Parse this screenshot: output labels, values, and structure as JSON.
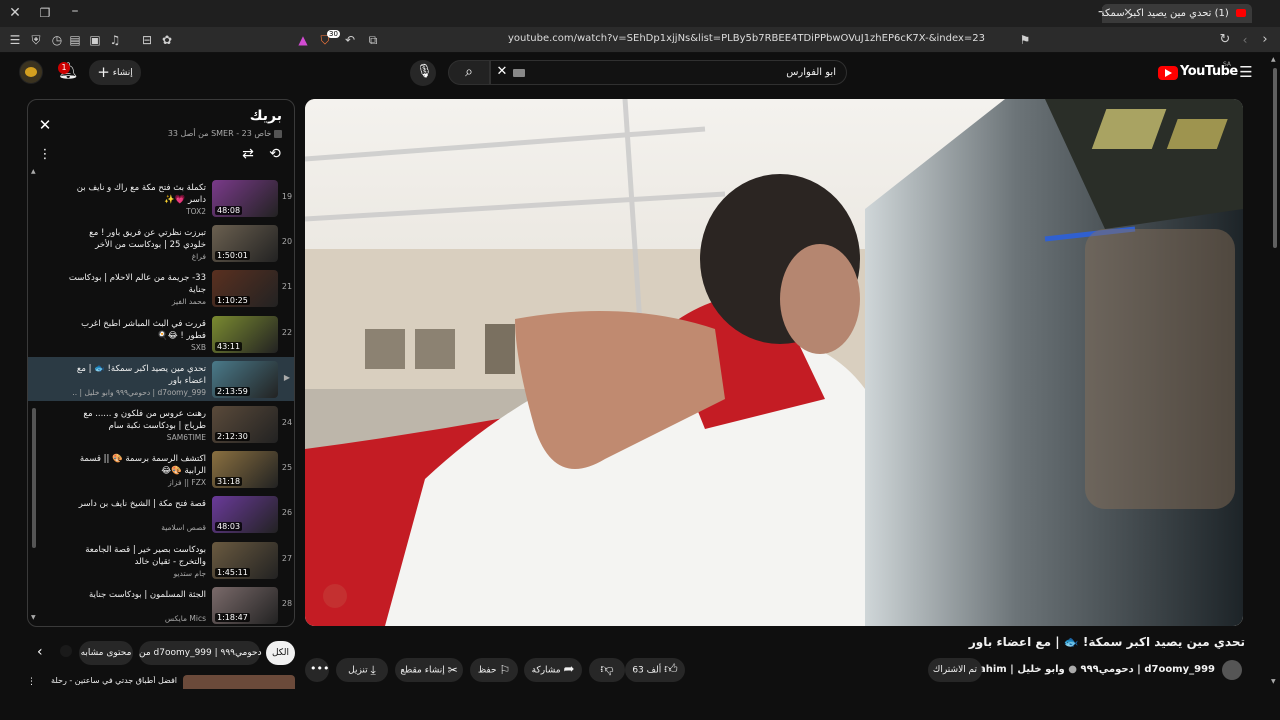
{
  "browser": {
    "tab_title": "(1) تحدي مين يصيد اكبر سمكة!",
    "url": "youtube.com/watch?v=SEhDp1xjjNs&list=PLBy5b7RBEE4TDiPPbwOVuJ1zhEP6cK7X-&index=23",
    "shield_count": "30"
  },
  "header": {
    "logo_text": "YouTube",
    "logo_region": "SA",
    "search_value": "ابو الفوارس",
    "create_label": "إنشاء",
    "notification_count": "1"
  },
  "playlist": {
    "title": "بريك",
    "subtitle": "23 من أصل 33",
    "owner": "SMER",
    "privacy": "خاص",
    "items": [
      {
        "index": "19",
        "title": "تكملة بث فتح مكة مع راك و نايف بن داسر",
        "emoji": "💗✨",
        "channel": "TOX2",
        "duration": "48:08",
        "color": "#7a3a8a"
      },
      {
        "index": "20",
        "title": "تبرزت نظرتي عن فريق باور ! مع خلودي 25 | بودكاست من الأخر",
        "emoji": "",
        "channel": "فراغ",
        "duration": "1:50:01",
        "color": "#6b6050"
      },
      {
        "index": "21",
        "title": "33- جريمة من عالم الاحلام | بودكاست جناية",
        "emoji": "",
        "channel": "محمد الفيز",
        "duration": "1:10:25",
        "color": "#5a3020"
      },
      {
        "index": "22",
        "title": "قررت في البث المباشر اطبخ اغرب فطور !",
        "emoji": "😂🍳",
        "channel": "SXB",
        "duration": "43:11",
        "color": "#7a8a30"
      },
      {
        "index": "▶",
        "title": "تحدي مين يصيد اكبر سمكة! 🐟 | مع اعضاء باور",
        "emoji": "",
        "channel": "d7oomy_999 | دحومي٩٩٩ وابو خليل | ..",
        "duration": "2:13:59",
        "color": "#4a7a8a"
      },
      {
        "index": "24",
        "title": "رهنت عروس من فلكون و ...... مع طرباج | بودكاست نكبة سام",
        "emoji": "",
        "channel": "SAM6TIME",
        "duration": "2:12:30",
        "color": "#5a4a3a"
      },
      {
        "index": "25",
        "title": "اكتشف الرسمة برسمة 🎨 || قسمة الرابية",
        "emoji": "🎨😂",
        "channel": "FZX || فزاز",
        "duration": "31:18",
        "color": "#8a7040"
      },
      {
        "index": "26",
        "title": "قصة فتح مكة | الشيخ نايف بن داسر",
        "emoji": "",
        "channel": "قصص اسلامية",
        "duration": "48:03",
        "color": "#6a3a9a"
      },
      {
        "index": "27",
        "title": "بودكاست بصير خير | قصة الجامعة والتخرج - ثقيان خالد",
        "emoji": "",
        "channel": "جام ستديو",
        "duration": "1:45:11",
        "color": "#6a5a40"
      },
      {
        "index": "28",
        "title": "الجثة المسلمون | بودكاست جناية",
        "emoji": "",
        "channel": "Mics مايكس",
        "duration": "1:18:47",
        "color": "#7a6a6a"
      }
    ]
  },
  "chips": [
    "الكل",
    "من d7oomy_999 | دحومي٩٩٩",
    "محتوى مشابه"
  ],
  "next_video_title": "افضل أطباق جدتي في ساعتين - رحلة طهي مع",
  "video": {
    "title": "تحدي مين يصيد اكبر سمكة! 🐟 | مع اعضاء باور",
    "channel": "d7oomy_999 | دحومي٩٩٩",
    "collab": "وابو خليل | Ibrahim",
    "subscribe_label": "تم الاشتراك",
    "likes": "63 ألف",
    "share_label": "مشاركة",
    "save_label": "حفظ",
    "clip_label": "إنشاء مقطع",
    "download_label": "تنزيل"
  }
}
